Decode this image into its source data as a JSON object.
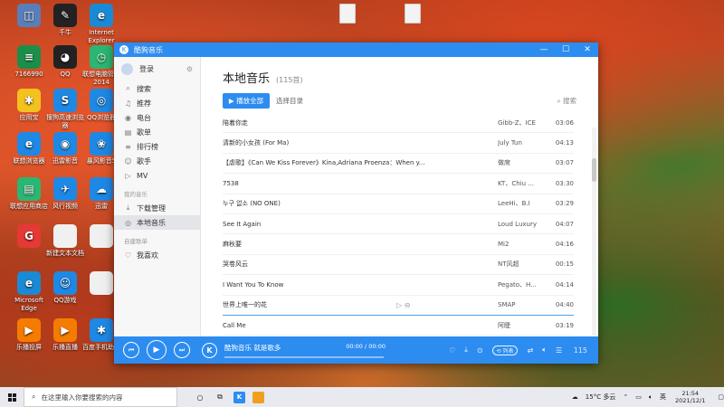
{
  "desktop": {
    "icons": [
      {
        "label": "",
        "color": "#5a7fb8",
        "glyph": "◫"
      },
      {
        "label": "7166990",
        "color": "#1b8e4a",
        "glyph": "≡"
      },
      {
        "label": "应用宝",
        "color": "#f4c21e",
        "glyph": "✱"
      },
      {
        "label": "联想浏览器",
        "color": "#1e88e5",
        "glyph": "e"
      },
      {
        "label": "联想应用商店",
        "color": "#2bb673",
        "glyph": "▤"
      },
      {
        "label": "",
        "color": "#e53935",
        "glyph": "G"
      },
      {
        "label": "Microsoft Edge",
        "color": "#1a8ad4",
        "glyph": "e"
      },
      {
        "label": "乐播投屏",
        "color": "#f57c00",
        "glyph": "▶"
      },
      {
        "label": "乐播直播",
        "color": "#f57c00",
        "glyph": "▶"
      },
      {
        "label": "千牛",
        "color": "#222",
        "glyph": "✎"
      },
      {
        "label": "QQ",
        "color": "#222",
        "glyph": "◕"
      },
      {
        "label": "搜狗高速浏览器",
        "color": "#1e88e5",
        "glyph": "S"
      },
      {
        "label": "风行视频",
        "color": "#1e88e5",
        "glyph": "✈"
      },
      {
        "label": "新建文本文档",
        "color": "#f0f0f0",
        "glyph": ""
      },
      {
        "label": "QQ游戏",
        "color": "#1e88e5",
        "glyph": "☺"
      },
      {
        "label": "迅雷影音",
        "color": "#1e88e5",
        "glyph": "◉"
      },
      {
        "label": "Internet Explorer",
        "color": "#1a8ad4",
        "glyph": "e"
      },
      {
        "label": "联想电脑管家2014",
        "color": "#2bb673",
        "glyph": "◷"
      },
      {
        "label": "QQ浏览器",
        "color": "#1e88e5",
        "glyph": "◎"
      },
      {
        "label": "暴风影音5",
        "color": "#1e88e5",
        "glyph": "❀"
      },
      {
        "label": "迅雷",
        "color": "#1e88e5",
        "glyph": "☁"
      },
      {
        "label": "",
        "color": "#f0f0f0",
        "glyph": ""
      },
      {
        "label": "",
        "color": "#f0f0f0",
        "glyph": ""
      },
      {
        "label": "百度手机助手",
        "color": "#1e88e5",
        "glyph": "✱"
      }
    ]
  },
  "window": {
    "title": "酷狗音乐",
    "sidebar": {
      "user": "登录",
      "nav": [
        {
          "label": "搜索",
          "icon": "search-icon"
        },
        {
          "label": "推荐",
          "icon": "recommend-icon"
        },
        {
          "label": "电台",
          "icon": "radio-icon"
        },
        {
          "label": "歌单",
          "icon": "playlist-icon"
        },
        {
          "label": "排行榜",
          "icon": "chart-icon"
        },
        {
          "label": "歌手",
          "icon": "singer-icon"
        },
        {
          "label": "MV",
          "icon": "mv-icon"
        }
      ],
      "my_music_title": "我的音乐",
      "my_music": [
        {
          "label": "下载管理",
          "icon": "download-icon"
        },
        {
          "label": "本地音乐",
          "icon": "disc-icon",
          "active": true
        }
      ],
      "created_title": "自建歌单",
      "created": [
        {
          "label": "我喜欢",
          "icon": "heart-icon"
        }
      ]
    },
    "main": {
      "title": "本地音乐",
      "count": "(115首)",
      "play_all": "▶ 播放全部",
      "choose_dir": "选择目录",
      "search": "搜索"
    },
    "tracks": [
      {
        "name": "陪着你走",
        "artist": "Gibb-Z、ICE",
        "duration": "03:06"
      },
      {
        "name": "清新的小女孩 (For Ma)",
        "artist": "July Tun",
        "duration": "04:13"
      },
      {
        "name": "【虐歌】《Can We Kiss Forever》Kina,Adriana Proenza：When y...",
        "artist": "做席",
        "duration": "03:07"
      },
      {
        "name": "7538",
        "artist": "KT、Chiu ...",
        "duration": "03:30"
      },
      {
        "name": "누구 없소 (NO ONE)",
        "artist": "LeeHi、B.I",
        "duration": "03:29"
      },
      {
        "name": "See It Again",
        "artist": "Loud Luxury",
        "duration": "04:07"
      },
      {
        "name": "麻秋要",
        "artist": "Mi2",
        "duration": "04:16"
      },
      {
        "name": "哭卷风云",
        "artist": "NT风超",
        "duration": "00:15"
      },
      {
        "name": "I Want You To Know",
        "artist": "Pegato、H...",
        "duration": "04:14"
      },
      {
        "name": "世界上唯一的花",
        "artist": "SMAP",
        "duration": "04:40"
      },
      {
        "name": "Call Me",
        "artist": "阿睫",
        "duration": "03:19"
      }
    ],
    "player": {
      "now_playing": "酷狗音乐 就是歌多",
      "time": "00:00 / 00:00",
      "mode": "⟲ 列表",
      "queue_count": "115"
    }
  },
  "taskbar": {
    "search_placeholder": "在这里输入你要搜索的内容",
    "weather": "15°C 多云",
    "time": "21:54",
    "date": "2021/12/1",
    "ime": "英"
  }
}
